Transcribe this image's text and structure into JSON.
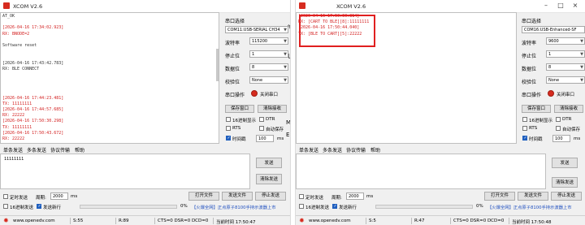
{
  "colors": {
    "accent": "#d62b1f",
    "timestamp": "#d32020",
    "highlight": "#e02020",
    "link_blue": "#1f4fbf"
  },
  "left": {
    "title": "XCOM V2.6",
    "recv_lines": [
      {
        "text": "AT_OK",
        "kind": "rx"
      },
      {
        "text": "",
        "kind": "rx"
      },
      {
        "text": "[2026-04-16 17:34:02.923]",
        "kind": "ts"
      },
      {
        "text": "RX: BNODE=2",
        "kind": "tx"
      },
      {
        "text": "",
        "kind": "rx"
      },
      {
        "text": "Software reset",
        "kind": "rx"
      },
      {
        "text": "",
        "kind": "rx"
      },
      {
        "text": "",
        "kind": "rx"
      },
      {
        "text": "[2026-04-16 17:43:42.783]",
        "kind": "rx"
      },
      {
        "text": "RX: BLE CONNECT",
        "kind": "rx"
      },
      {
        "text": "",
        "kind": "rx"
      },
      {
        "text": "",
        "kind": "rx"
      },
      {
        "text": "",
        "kind": "rx"
      },
      {
        "text": "",
        "kind": "rx"
      },
      {
        "text": "[2026-04-16 17:44:23.481]",
        "kind": "ts"
      },
      {
        "text": "TX: 11111111",
        "kind": "tx"
      },
      {
        "text": "[2026-04-16 17:44:57.685]",
        "kind": "ts"
      },
      {
        "text": "RX: 22222",
        "kind": "tx"
      },
      {
        "text": "[2026-04-16 17:50:30.298]",
        "kind": "ts"
      },
      {
        "text": "TX: 11111111",
        "kind": "tx"
      },
      {
        "text": "[2026-04-16 17:50:43.672]",
        "kind": "ts"
      },
      {
        "text": "RX: 22222",
        "kind": "tx"
      }
    ],
    "port_label": "串口选择",
    "port_value": "COM11:USB-SERIAL CH34",
    "baud_label": "波特率",
    "baud_value": "115200",
    "stop_label": "停止位",
    "stop_value": "1",
    "data_label": "数据位",
    "data_value": "8",
    "parity_label": "校验位",
    "parity_value": "None",
    "op_label": "串口操作",
    "close_port": "关闭串口",
    "save_window": "保存窗口",
    "clear_recv": "清除接收",
    "hex_display": "16进制显示",
    "dtr": "DTR",
    "rts": "RTS",
    "auto_save": "自动保存",
    "timestamp": "时间戳",
    "timestamp_ms": "100",
    "ms": "ms",
    "tabs": [
      "单条发送",
      "多条发送",
      "协议传输",
      "帮助"
    ],
    "send_text": "11111111",
    "send_btn": "发送",
    "clear_send": "清除发送",
    "timed_send": "定时发送",
    "period_label": "周期:",
    "period_value": "2000",
    "period_ms": "ms",
    "hex_send": "16进制发送",
    "newline_send": "发送新行",
    "ok": "0%",
    "open_file": "打开文件",
    "send_file": "发送文件",
    "stop_send": "停止发送",
    "promo": "【火爆全网】正点原子8100手持示波器上市",
    "status_url": "www.openedv.com",
    "status_s": "S:55",
    "status_r": "R:89",
    "status_cts": "CTS=0 DSR=0 DCD=0",
    "status_time": "当前时间 17:50:47",
    "behind_text_1": "传",
    "behind_text_2": "U",
    "behind_text_3": "M,",
    "behind_text_4": "E."
  },
  "right": {
    "title": "XCOM V2.6",
    "recv_lines": [
      {
        "text": "[2026-04-16 17:50:30.814]",
        "kind": "ts"
      },
      {
        "text": "RX: [CART TO BLE][8]:11111111",
        "kind": "tx"
      },
      {
        "text": "[2026-04-16 17:50:44.040]",
        "kind": "ts"
      },
      {
        "text": "TX: [BLE TO CART][5]:22222",
        "kind": "tx"
      }
    ],
    "port_label": "串口选择",
    "port_value": "COM16:USB-Enhanced-SF",
    "baud_label": "波特率",
    "baud_value": "9600",
    "stop_label": "停止位",
    "stop_value": "1",
    "data_label": "数据位",
    "data_value": "8",
    "parity_label": "校验位",
    "parity_value": "None",
    "op_label": "串口操作",
    "close_port": "关闭串口",
    "save_window": "保存窗口",
    "clear_recv": "清除接收",
    "hex_display": "16进制显示",
    "dtr": "DTR",
    "rts": "RTS",
    "auto_save": "自动保存",
    "timestamp": "时间戳",
    "timestamp_ms": "100",
    "ms": "ms",
    "tabs": [
      "单条发送",
      "多条发送",
      "协议传输",
      "帮助"
    ],
    "send_btn": "发送",
    "clear_send": "清除发送",
    "timed_send": "定时发送",
    "period_label": "周期:",
    "period_value": "2000",
    "period_ms": "ms",
    "hex_send": "16进制发送",
    "newline_send": "发送新行",
    "ok": "0%",
    "open_file": "打开文件",
    "send_file": "发送文件",
    "stop_send": "停止发送",
    "promo": "【火爆全网】正点原子8100手持示波器上市",
    "status_url": "www.openedv.com",
    "status_s": "S:5",
    "status_r": "R:47",
    "status_cts": "CTS=0 DSR=0 DCD=0",
    "status_time": "当前时间 17:50:48"
  }
}
